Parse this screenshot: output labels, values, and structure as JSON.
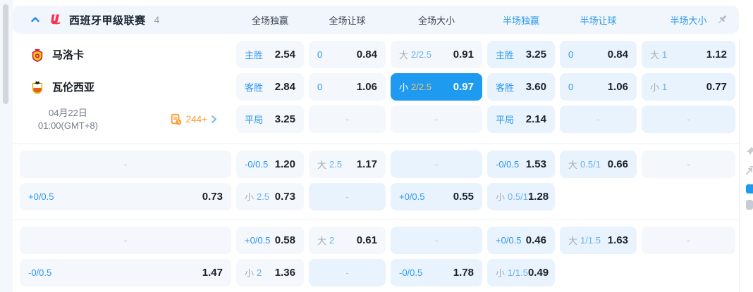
{
  "header": {
    "league_title": "西班牙甲级联赛",
    "match_count": "4",
    "cols": {
      "c1": "全场独赢",
      "c2": "全场让球",
      "c3": "全场大小",
      "c4": "半场独赢",
      "c5": "半场让球",
      "c6": "半场大小"
    }
  },
  "match": {
    "home_team": "马洛卡",
    "away_team": "瓦伦西亚",
    "date": "04月22日",
    "time": "01:00(GMT+8)",
    "more_markets": "244+"
  },
  "icons": {
    "collapse": "chevron-up-icon",
    "league_logo": "laliga-logo-icon",
    "pin": "pushpin-icon",
    "markets": "odds-list-clock-icon",
    "forward": "chevron-right-icon"
  },
  "colors": {
    "accent_blue": "#2a97f3",
    "active_cell_bg": "#1e9bf0",
    "active_line_gold": "#f2c468",
    "markets_orange": "#ff9a2e",
    "full_cell_bg": "#f4f7fb",
    "half_cell_bg": "#e9f3fd"
  },
  "odds": {
    "r1": {
      "c1": {
        "p": "主胜",
        "v": "2.54"
      },
      "c2": {
        "p": "0",
        "v": "0.84"
      },
      "c3": {
        "p": "大",
        "l": "2/2.5",
        "v": "0.91"
      },
      "c4": {
        "p": "主胜",
        "v": "3.25"
      },
      "c5": {
        "p": "0",
        "v": "0.84"
      },
      "c6": {
        "p": "大",
        "l": "1",
        "v": "1.12"
      }
    },
    "r2": {
      "c1": {
        "p": "客胜",
        "v": "2.84"
      },
      "c2": {
        "p": "0",
        "v": "1.06"
      },
      "c3": {
        "p": "小",
        "l": "2/2.5",
        "v": "0.97"
      },
      "c4": {
        "p": "客胜",
        "v": "3.60"
      },
      "c5": {
        "p": "0",
        "v": "1.06"
      },
      "c6": {
        "p": "小",
        "l": "1",
        "v": "0.77"
      }
    },
    "r3": {
      "c1": {
        "p": "平局",
        "v": "3.25"
      },
      "c2": {
        "v": "-"
      },
      "c3": {
        "v": "-"
      },
      "c4": {
        "p": "平局",
        "v": "2.14"
      },
      "c5": {
        "v": "-"
      },
      "c6": {
        "v": "-"
      }
    },
    "r4": {
      "c1": {
        "v": "-"
      },
      "c2": {
        "p": "-0/0.5",
        "v": "1.20"
      },
      "c3": {
        "p": "大",
        "l": "2.5",
        "v": "1.17"
      },
      "c4": {
        "v": "-"
      },
      "c5": {
        "p": "-0/0.5",
        "v": "1.53"
      },
      "c6": {
        "p": "大",
        "l": "0.5/1",
        "v": "0.66"
      }
    },
    "r5": {
      "c1": {
        "v": "-"
      },
      "c2": {
        "p": "+0/0.5",
        "v": "0.73"
      },
      "c3": {
        "p": "小",
        "l": "2.5",
        "v": "0.73"
      },
      "c4": {
        "v": "-"
      },
      "c5": {
        "p": "+0/0.5",
        "v": "0.55"
      },
      "c6": {
        "p": "小",
        "l": "0.5/1",
        "v": "1.28"
      }
    },
    "r6": {
      "c1": {
        "v": "-"
      },
      "c2": {
        "p": "+0/0.5",
        "v": "0.58"
      },
      "c3": {
        "p": "大",
        "l": "2",
        "v": "0.61"
      },
      "c4": {
        "v": "-"
      },
      "c5": {
        "p": "+0/0.5",
        "v": "0.46"
      },
      "c6": {
        "p": "大",
        "l": "1/1.5",
        "v": "1.63"
      }
    },
    "r7": {
      "c1": {
        "v": "-"
      },
      "c2": {
        "p": "-0/0.5",
        "v": "1.47"
      },
      "c3": {
        "p": "小",
        "l": "2",
        "v": "1.36"
      },
      "c4": {
        "v": "-"
      },
      "c5": {
        "p": "-0/0.5",
        "v": "1.78"
      },
      "c6": {
        "p": "小",
        "l": "1/1.5",
        "v": "0.49"
      }
    }
  }
}
